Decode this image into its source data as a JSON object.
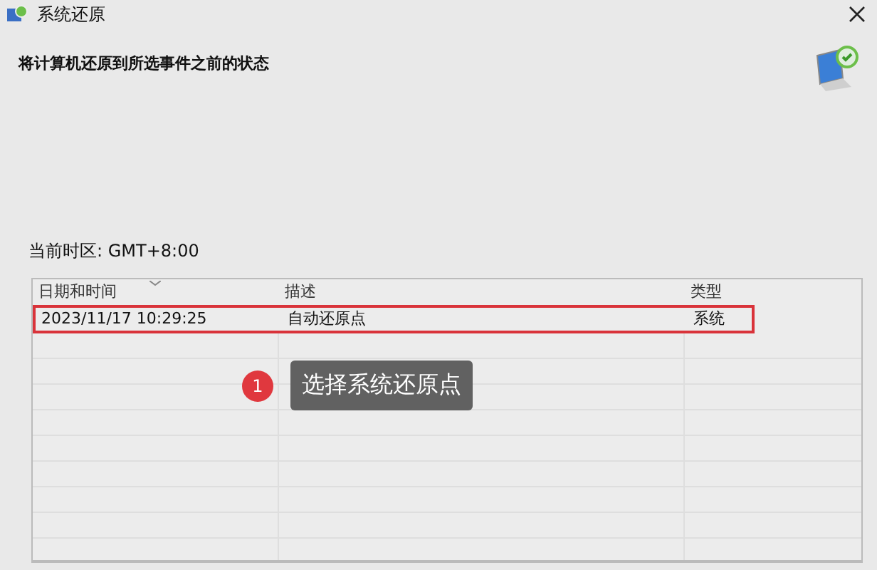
{
  "window": {
    "title": "系统还原"
  },
  "header": {
    "text": "将计算机还原到所选事件之前的状态"
  },
  "timezone": "当前时区: GMT+8:00",
  "table": {
    "columns": [
      "日期和时间",
      "描述",
      "类型"
    ],
    "rows": [
      {
        "cells": [
          "2023/11/17 10:29:25",
          "自动还原点",
          "系统"
        ],
        "selected": true
      }
    ]
  },
  "callout": {
    "number": "1",
    "text": "选择系统还原点"
  }
}
